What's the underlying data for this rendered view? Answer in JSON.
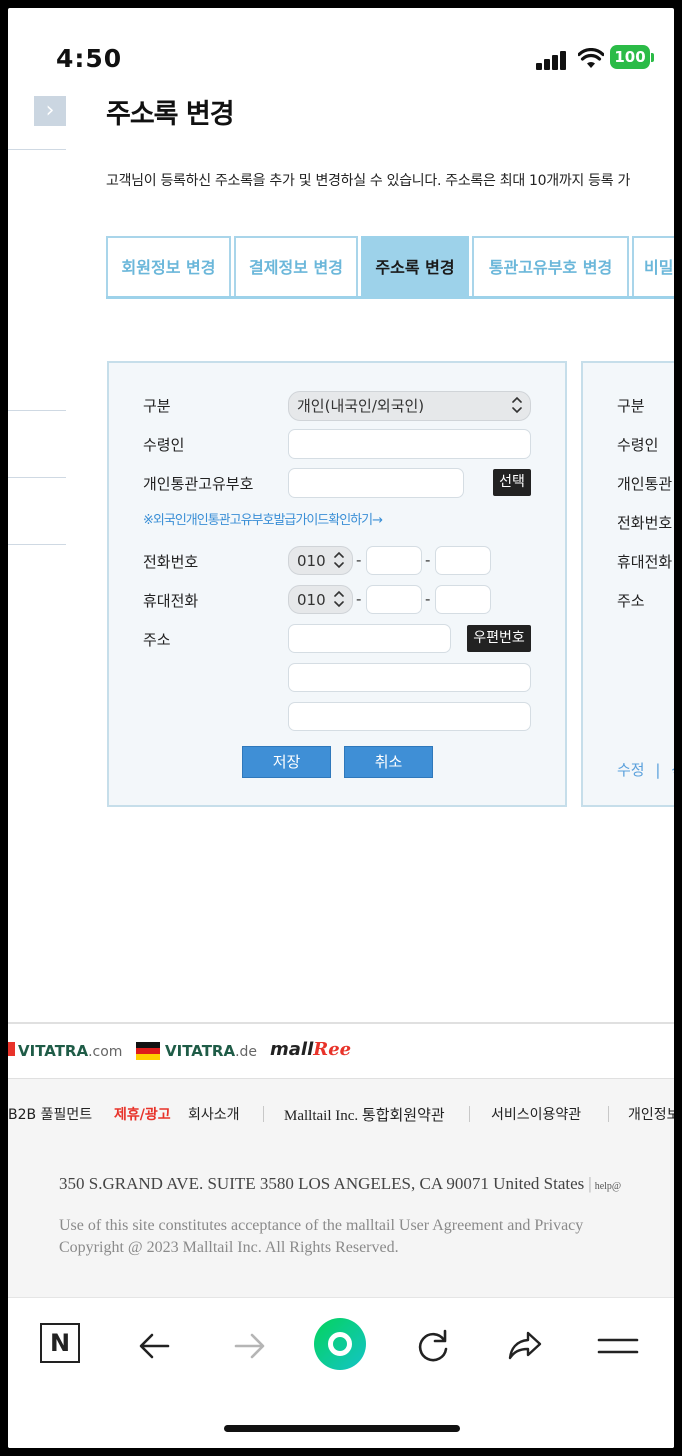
{
  "status_bar": {
    "time": "4:50",
    "battery": "100"
  },
  "page": {
    "title": "주소록 변경",
    "description": "고객님이 등록하신 주소록을 추가 및 변경하실 수 있습니다. 주소록은 최대 10개까지 등록 가"
  },
  "tabs": [
    {
      "label": "회원정보 변경",
      "active": false
    },
    {
      "label": "결제정보 변경",
      "active": false
    },
    {
      "label": "주소록 변경",
      "active": true
    },
    {
      "label": "통관고유부호 변경",
      "active": false
    },
    {
      "label": "비밀",
      "active": false
    }
  ],
  "form": {
    "type_label": "구분",
    "type_value": "개인(내국인/외국인)",
    "recipient_label": "수령인",
    "recipient_value": "",
    "customs_label": "개인통관고유부호",
    "customs_value": "",
    "select_button": "선택",
    "guide_link": "※외국인개인통관고유부호발급가이드확인하기→",
    "phone_label": "전화번호",
    "phone_prefix": "010",
    "phone_mid": "",
    "phone_last": "",
    "mobile_label": "휴대전화",
    "mobile_prefix": "010",
    "mobile_mid": "",
    "mobile_last": "",
    "dash": "-",
    "address_label": "주소",
    "zip_value": "",
    "zip_button": "우편번호",
    "address1": "",
    "address2": "",
    "save_button": "저장",
    "cancel_button": "취소"
  },
  "saved_address": {
    "type_label": "구분",
    "recipient_label": "수령인",
    "customs_label": "개인통관",
    "phone_label": "전화번호",
    "mobile_label": "휴대전화",
    "address_label": "주소",
    "edit_link": "수정",
    "separator": "|",
    "delete_link": "삭"
  },
  "footer": {
    "logos": [
      {
        "text": "VITATRA",
        "suffix": ".com"
      },
      {
        "text": "VITATRA",
        "suffix": ".de"
      },
      {
        "text": "mall",
        "suffix": "Ree"
      }
    ],
    "links": [
      {
        "label": "B2B 풀필먼트",
        "highlight": false
      },
      {
        "label": "제휴/광고",
        "highlight": true
      },
      {
        "label": "회사소개",
        "highlight": false
      },
      {
        "label": "Malltail Inc. 통합회원약관",
        "highlight": false
      },
      {
        "label": "서비스이용약관",
        "highlight": false
      },
      {
        "label": "개인정보",
        "highlight": false
      }
    ],
    "address": "350 S.GRAND AVE. SUITE 3580 LOS ANGELES, CA 90071 United States",
    "help_email": "help@",
    "notice": "Use of this site constitutes acceptance of the malltail User Agreement and Privacy",
    "copyright": "Copyright @ 2023 Malltail Inc. All Rights Reserved."
  },
  "browser_nav": [
    {
      "icon": "naver-n-icon",
      "letter": "N"
    },
    {
      "icon": "back-arrow-icon"
    },
    {
      "icon": "forward-arrow-icon"
    },
    {
      "icon": "green-home-icon"
    },
    {
      "icon": "reload-icon"
    },
    {
      "icon": "share-icon"
    },
    {
      "icon": "menu-icon"
    }
  ],
  "colors": {
    "tab_active": "#9dd2ea",
    "tab_text": "#6bb7da",
    "primary_button": "#3f8fd6",
    "battery": "#2bbb47",
    "highlight_link": "#e8332a",
    "naver_green": "#03c75a"
  }
}
